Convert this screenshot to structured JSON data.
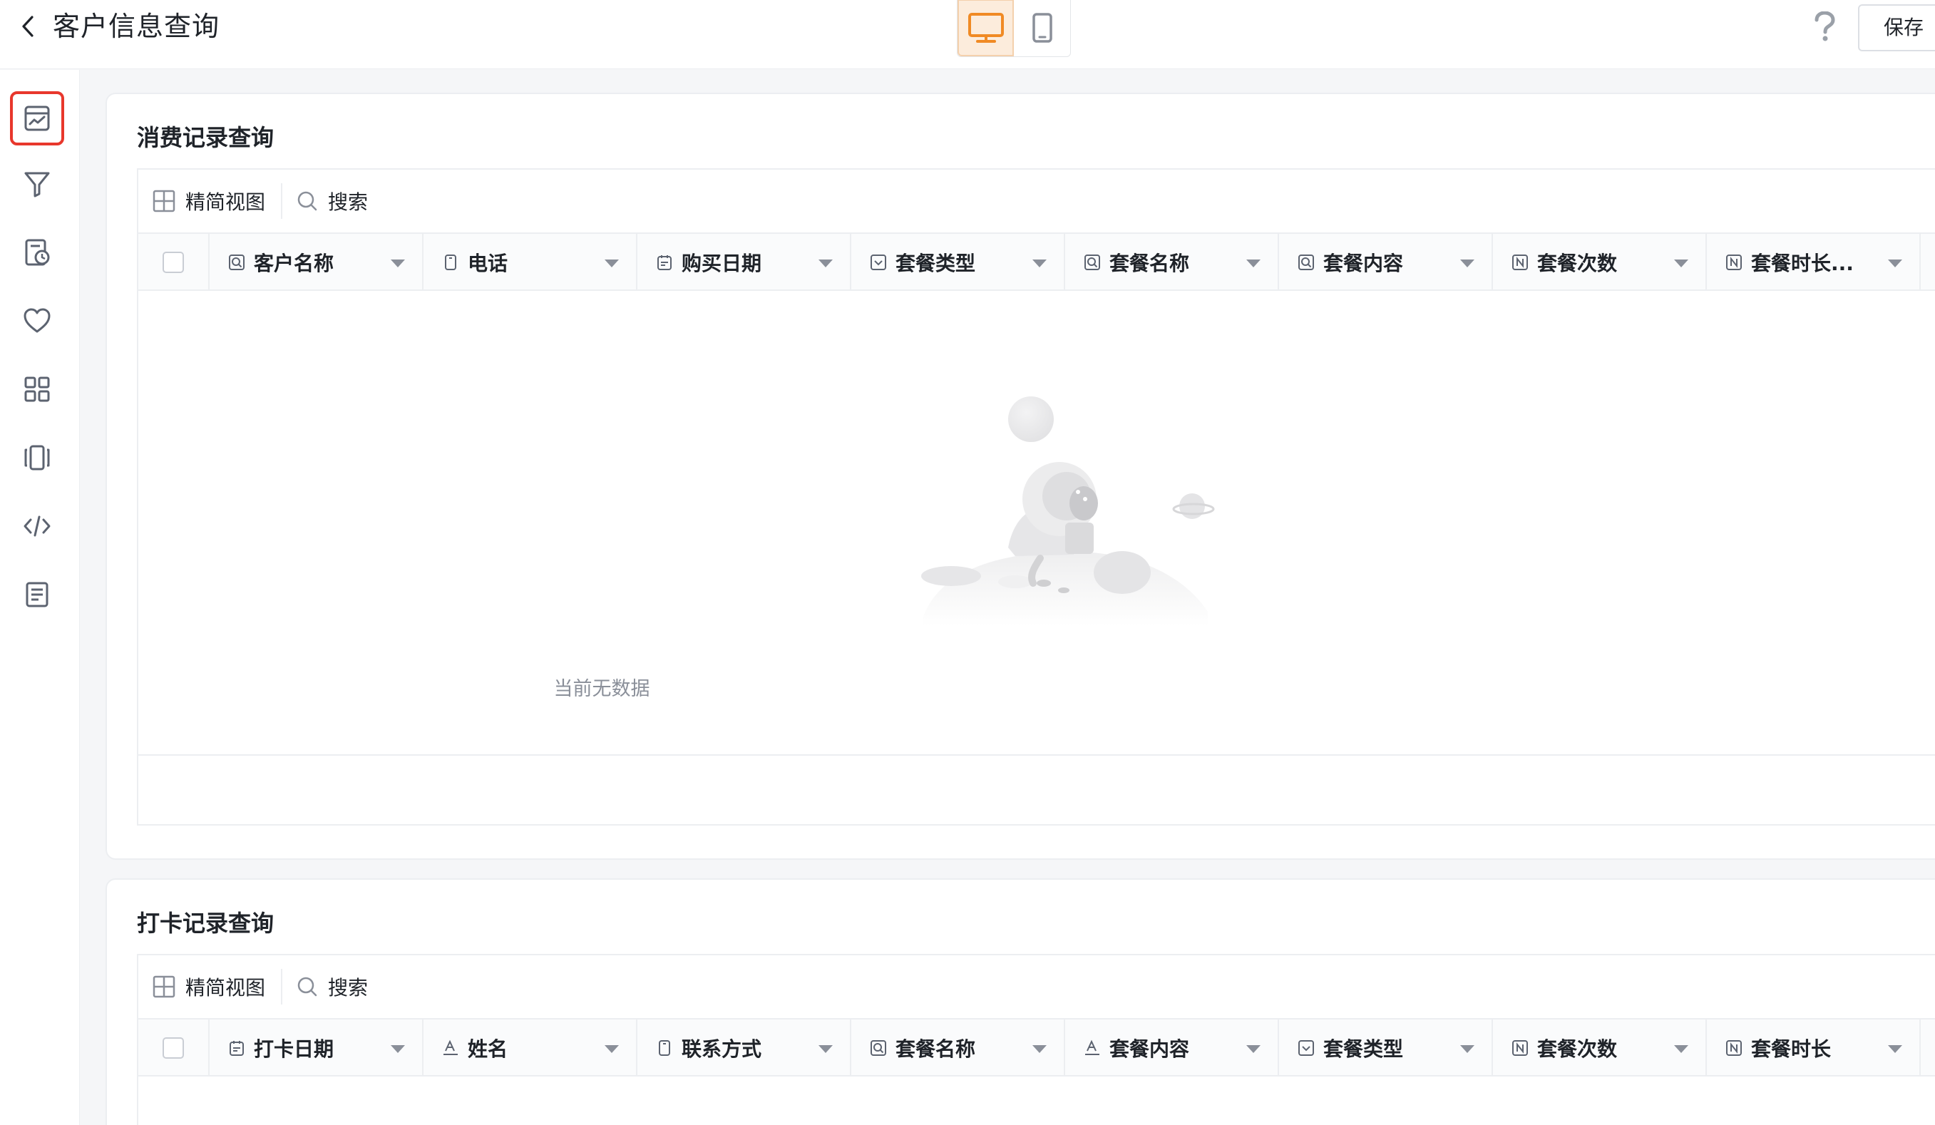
{
  "header": {
    "title": "客户信息查询",
    "save_label": "保存"
  },
  "card_consumption": {
    "title": "消费记录查询",
    "toolbar": {
      "view_label": "精简视图",
      "search_label": "搜索"
    },
    "columns": [
      {
        "label": "客户名称",
        "icon": "search-field-icon"
      },
      {
        "label": "电话",
        "icon": "phone-field-icon"
      },
      {
        "label": "购买日期",
        "icon": "date-field-icon"
      },
      {
        "label": "套餐类型",
        "icon": "select-field-icon"
      },
      {
        "label": "套餐名称",
        "icon": "search-field-icon"
      },
      {
        "label": "套餐内容",
        "icon": "search-field-icon"
      },
      {
        "label": "套餐次数",
        "icon": "number-field-icon"
      },
      {
        "label": "套餐时长...",
        "icon": "number-field-icon"
      }
    ],
    "empty_text": "当前无数据"
  },
  "card_checkin": {
    "title": "打卡记录查询",
    "toolbar": {
      "view_label": "精简视图",
      "search_label": "搜索"
    },
    "columns": [
      {
        "label": "打卡日期",
        "icon": "date-field-icon"
      },
      {
        "label": "姓名",
        "icon": "text-field-icon"
      },
      {
        "label": "联系方式",
        "icon": "phone-field-icon"
      },
      {
        "label": "套餐名称",
        "icon": "search-field-icon"
      },
      {
        "label": "套餐内容",
        "icon": "text-field-icon"
      },
      {
        "label": "套餐类型",
        "icon": "select-field-icon"
      },
      {
        "label": "套餐次数",
        "icon": "number-field-icon"
      },
      {
        "label": "套餐时长",
        "icon": "number-field-icon"
      }
    ]
  },
  "rail": {
    "items": [
      "chart-icon",
      "filter-icon",
      "schedule-icon",
      "heart-icon",
      "grid-icon",
      "carousel-icon",
      "code-icon",
      "document-icon"
    ],
    "active_index": 0
  },
  "colors": {
    "accent": "#f08a24",
    "active_outline": "#e8372c",
    "border": "#eceef1"
  }
}
